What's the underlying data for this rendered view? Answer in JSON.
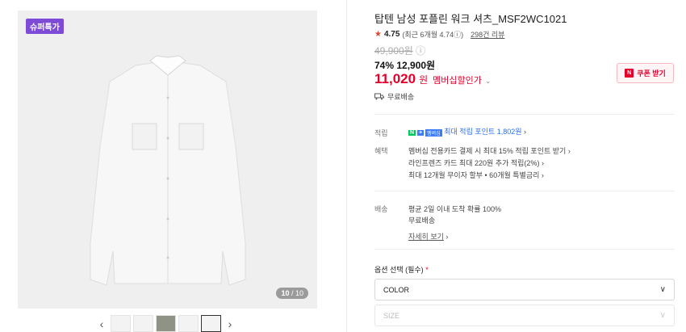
{
  "gallery": {
    "badge": "슈퍼특가",
    "counter_current": "10",
    "counter_total": "/ 10",
    "prev_arrow": "‹",
    "next_arrow": "›"
  },
  "product": {
    "title": "탑텐 남성 포플린 워크 셔츠_MSF2WC1021",
    "rating": "4.75",
    "rating_detail": "(최근 6개월 4.74",
    "info_icon": "ⓘ",
    "rating_close": ")",
    "reviews": "298건 리뷰",
    "original_price": "49,900원",
    "sale": "74% 12,900원",
    "member_price": "11,020",
    "member_won": "원",
    "member_label": "멤버십할인가",
    "coupon": "쿠폰 받기",
    "coupon_icon": "N",
    "shipping": "무료배송"
  },
  "points": {
    "label": "적립",
    "text": "최대 적립 포인트 1,802원",
    "naver_g": "N",
    "naver_plus": "+",
    "naver_m": "멤버십"
  },
  "benefits": {
    "label": "혜택",
    "lines": [
      "멤버십 전용카드 결제 시 최대 15% 적립 포인트 받기 ›",
      "라인프렌즈 카드 최대 220원 추가 적립(2%) ›",
      "최대 12개월 무이자 할부 • 60개월 특별금리 ›"
    ]
  },
  "delivery": {
    "label": "배송",
    "line1": "평균 2일 이내 도착 확률 100%",
    "line2": "무료배송",
    "detail_link": "자세히 보기",
    "detail_chev": "›"
  },
  "options": {
    "label": "옵션 선택 (필수)",
    "required_mark": "*",
    "color": "COLOR",
    "size": "SIZE",
    "chevron": "∨"
  }
}
